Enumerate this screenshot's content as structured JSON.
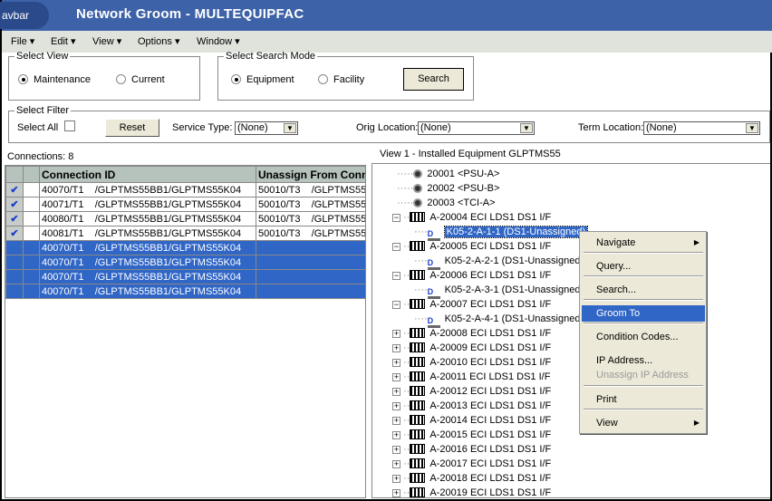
{
  "title_bar": {
    "nav_tab": "avbar",
    "title": "Network Groom -  MULTEQUIPFAC"
  },
  "menu": [
    "File",
    "Edit",
    "View",
    "Options",
    "Window"
  ],
  "select_view": {
    "legend": "Select View",
    "options": [
      {
        "label": "Maintenance",
        "selected": true
      },
      {
        "label": "Current",
        "selected": false
      }
    ]
  },
  "search_mode": {
    "legend": "Select Search Mode",
    "options": [
      {
        "label": "Equipment",
        "selected": true
      },
      {
        "label": "Facility",
        "selected": false
      }
    ],
    "search_button": "Search"
  },
  "filter": {
    "legend": "Select Filter",
    "select_all_label": "Select All",
    "select_all_checked": false,
    "reset_button": "Reset",
    "service_type_label": "Service Type:",
    "service_type_value": "(None)",
    "orig_location_label": "Orig Location:",
    "orig_location_value": "(None)",
    "term_location_label": "Term Location:",
    "term_location_value": "(None)"
  },
  "connections": {
    "count_label": "Connections: 8",
    "columns": [
      "",
      "",
      "Connection ID",
      "Unassign From Conne"
    ],
    "rows": [
      {
        "checked": true,
        "selected": false,
        "conn": "40070/T1    /GLPTMS55BB1/GLPTMS55K04",
        "unassign": "50010/T3    /GLPTMS55"
      },
      {
        "checked": true,
        "selected": false,
        "conn": "40071/T1    /GLPTMS55BB1/GLPTMS55K04",
        "unassign": "50010/T3    /GLPTMS55"
      },
      {
        "checked": true,
        "selected": false,
        "conn": "40080/T1    /GLPTMS55BB1/GLPTMS55K04",
        "unassign": "50010/T3    /GLPTMS55"
      },
      {
        "checked": true,
        "selected": false,
        "conn": "40081/T1    /GLPTMS55BB1/GLPTMS55K04",
        "unassign": "50010/T3    /GLPTMS55"
      },
      {
        "checked": false,
        "selected": true,
        "conn": "40070/T1    /GLPTMS55BB1/GLPTMS55K04",
        "unassign": ""
      },
      {
        "checked": false,
        "selected": true,
        "conn": "40070/T1    /GLPTMS55BB1/GLPTMS55K04",
        "unassign": ""
      },
      {
        "checked": false,
        "selected": true,
        "conn": "40070/T1    /GLPTMS55BB1/GLPTMS55K04",
        "unassign": ""
      },
      {
        "checked": false,
        "selected": true,
        "conn": "40070/T1    /GLPTMS55BB1/GLPTMS55K04",
        "unassign": ""
      }
    ]
  },
  "tree": {
    "label": "View 1 - Installed Equipment  GLPTMS55",
    "nodes": [
      {
        "type": "unit",
        "text": "20001 <PSU-A>"
      },
      {
        "type": "unit",
        "text": "20002 <PSU-B>"
      },
      {
        "type": "unit",
        "text": "20003 <TCI-A>"
      },
      {
        "type": "card",
        "text": "A-20004 ECI LDS1 DS1 I/F",
        "expanded": true
      },
      {
        "type": "port",
        "text": "K05-2-A-1-1 (DS1-Unassigned)",
        "selected": true
      },
      {
        "type": "card",
        "text": "A-20005 ECI LDS1 DS1 I/F",
        "expanded": true
      },
      {
        "type": "port",
        "text": "K05-2-A-2-1 (DS1-Unassigned)"
      },
      {
        "type": "card",
        "text": "A-20006 ECI LDS1 DS1 I/F",
        "expanded": true
      },
      {
        "type": "port",
        "text": "K05-2-A-3-1 (DS1-Unassigned)"
      },
      {
        "type": "card",
        "text": "A-20007 ECI LDS1 DS1 I/F",
        "expanded": true
      },
      {
        "type": "port",
        "text": "K05-2-A-4-1 (DS1-Unassigned)"
      },
      {
        "type": "card",
        "text": "A-20008 ECI LDS1 DS1 I/F"
      },
      {
        "type": "card",
        "text": "A-20009 ECI LDS1 DS1 I/F"
      },
      {
        "type": "card",
        "text": "A-20010 ECI LDS1 DS1 I/F"
      },
      {
        "type": "card",
        "text": "A-20011 ECI LDS1 DS1 I/F"
      },
      {
        "type": "card",
        "text": "A-20012 ECI LDS1 DS1 I/F"
      },
      {
        "type": "card",
        "text": "A-20013 ECI LDS1 DS1 I/F"
      },
      {
        "type": "card",
        "text": "A-20014 ECI LDS1 DS1 I/F"
      },
      {
        "type": "card",
        "text": "A-20015 ECI LDS1 DS1 I/F"
      },
      {
        "type": "card",
        "text": "A-20016 ECI LDS1 DS1 I/F"
      },
      {
        "type": "card",
        "text": "A-20017 ECI LDS1 DS1 I/F"
      },
      {
        "type": "card",
        "text": "A-20018 ECI LDS1 DS1 I/F"
      },
      {
        "type": "card",
        "text": "A-20019 ECI LDS1 DS1 I/F"
      }
    ]
  },
  "context_menu": [
    {
      "label": "Navigate",
      "submenu": true
    },
    {
      "sep": true
    },
    {
      "label": "Query..."
    },
    {
      "label": "Search..."
    },
    {
      "sep": true
    },
    {
      "label": "Groom To",
      "highlighted": true
    },
    {
      "sep": true
    },
    {
      "label": "Condition Codes..."
    },
    {
      "sep": true
    },
    {
      "label": "IP Address..."
    },
    {
      "label": "Unassign IP Address",
      "disabled": true
    },
    {
      "sep": true
    },
    {
      "label": "Print"
    },
    {
      "sep": true
    },
    {
      "label": "View",
      "submenu": true
    }
  ]
}
